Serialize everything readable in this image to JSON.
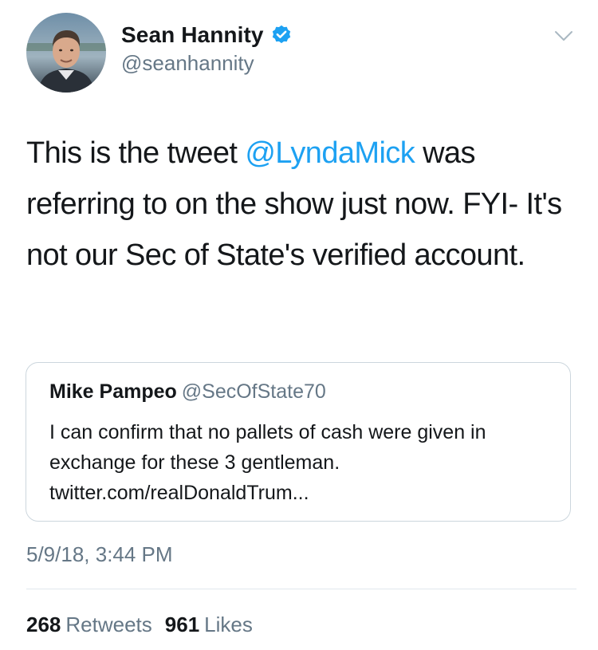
{
  "author": {
    "display_name": "Sean Hannity",
    "handle": "@seanhannity",
    "verified_icon": "verified-badge-icon",
    "verified_color": "#1da1f2"
  },
  "tweet": {
    "text_before": "This is the tweet ",
    "mention": "@LyndaMick",
    "text_after": " was referring to on the show just now. FYI- It's not our Sec of State's verified account.",
    "mention_color": "#1da1f2",
    "timestamp": "5/9/18, 3:44 PM"
  },
  "quoted_tweet": {
    "name": "Mike Pampeo",
    "handle": "@SecOfState70",
    "text": "I can confirm that no pallets of cash were given in exchange for these 3 gentleman. twitter.com/realDonaldTrum..."
  },
  "stats": {
    "retweets_count": "268",
    "retweets_label": "Retweets",
    "likes_count": "961",
    "likes_label": "Likes"
  },
  "menu": {
    "icon": "chevron-down-icon"
  }
}
